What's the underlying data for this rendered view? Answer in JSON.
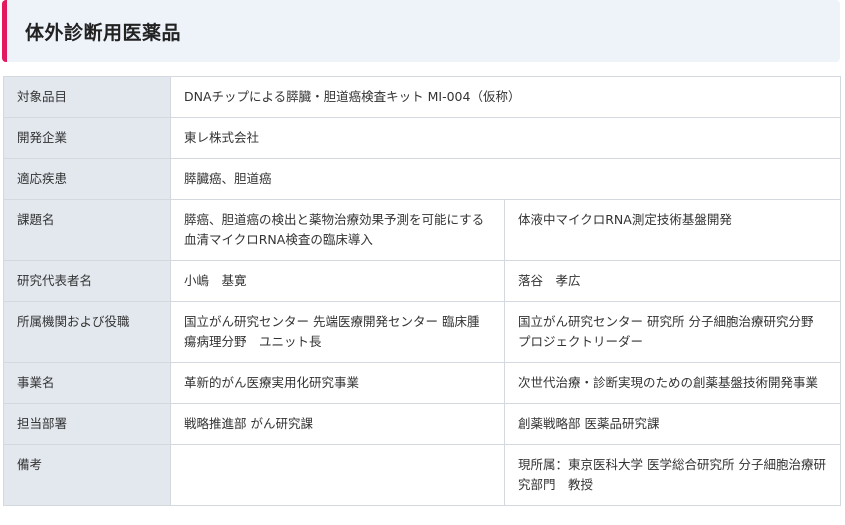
{
  "header": {
    "title": "体外診断用医薬品",
    "accent_color": "#e3195f",
    "background_color": "#eef3fa"
  },
  "table": {
    "label_background": "#e3e8ef",
    "border_color": "#d4d9e0",
    "rows": [
      {
        "label": "対象品目",
        "values": [
          "DNAチップによる膵臓・胆道癌検査キット MI-004（仮称）"
        ]
      },
      {
        "label": "開発企業",
        "values": [
          "東レ株式会社"
        ]
      },
      {
        "label": "適応疾患",
        "values": [
          "膵臓癌、胆道癌"
        ]
      },
      {
        "label": "課題名",
        "values": [
          "膵癌、胆道癌の検出と薬物治療効果予測を可能にする血清マイクロRNA検査の臨床導入",
          "体液中マイクロRNA測定技術基盤開発"
        ]
      },
      {
        "label": "研究代表者名",
        "values": [
          "小嶋　基寛",
          "落谷　孝広"
        ]
      },
      {
        "label": "所属機関および役職",
        "values": [
          "国立がん研究センター 先端医療開発センター 臨床腫瘍病理分野　ユニット長",
          "国立がん研究センター 研究所 分子細胞治療研究分野　プロジェクトリーダー"
        ]
      },
      {
        "label": "事業名",
        "values": [
          "革新的がん医療実用化研究事業",
          "次世代治療・診断実現のための創薬基盤技術開発事業"
        ]
      },
      {
        "label": "担当部署",
        "values": [
          "戦略推進部 がん研究課",
          "創薬戦略部 医薬品研究課"
        ]
      },
      {
        "label": "備考",
        "values": [
          "",
          "現所属：東京医科大学 医学総合研究所 分子細胞治療研究部門　教授"
        ]
      }
    ]
  }
}
